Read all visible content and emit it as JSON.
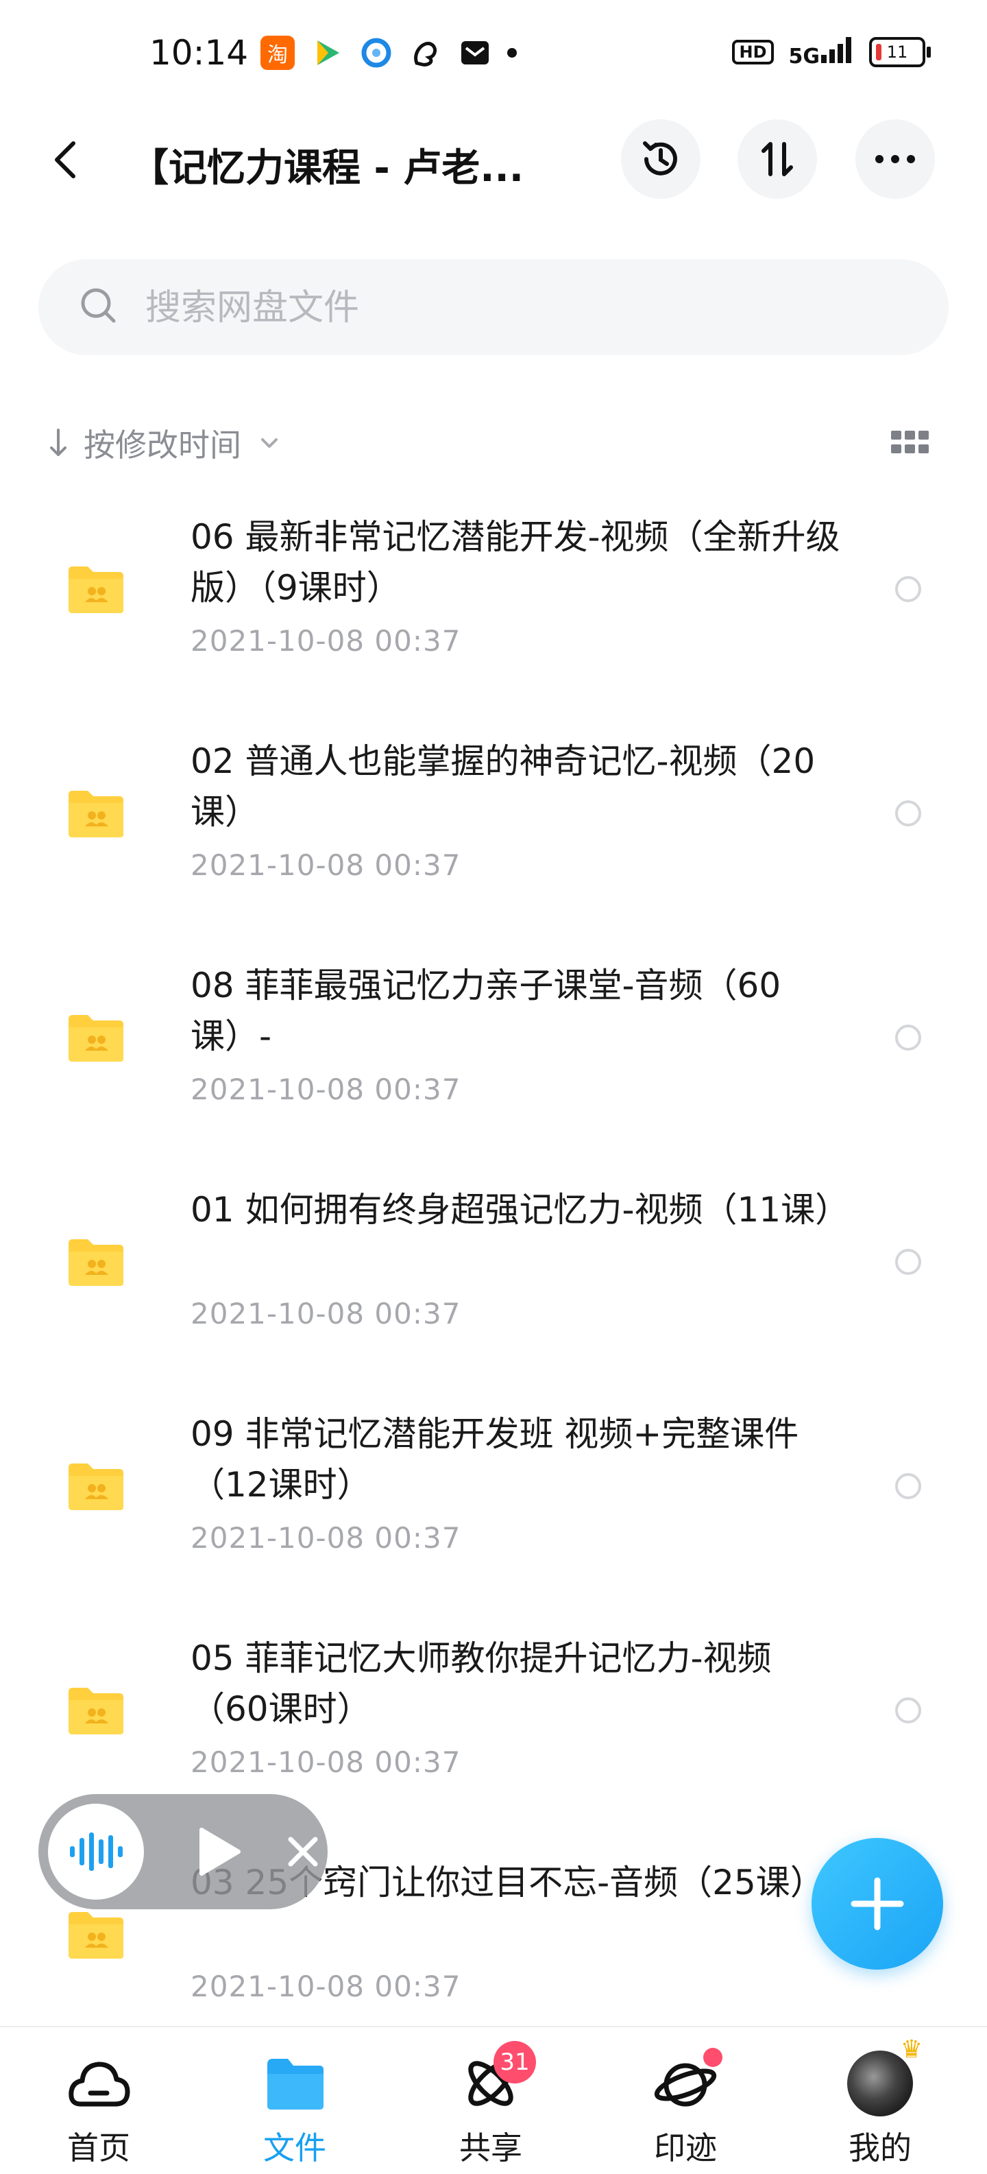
{
  "status_bar": {
    "time": "10:14",
    "network": "5G",
    "hd": "HD",
    "battery": "11"
  },
  "header": {
    "title": "【记忆力课程 - 卢老..."
  },
  "search": {
    "placeholder": "搜索网盘文件"
  },
  "sort": {
    "label": "按修改时间"
  },
  "files": [
    {
      "name": "06 最新非常记忆潜能开发-视频（全新升级版）（9课时）",
      "date": "2021-10-08  00:37"
    },
    {
      "name": "02 普通人也能掌握的神奇记忆-视频（20课）",
      "date": "2021-10-08  00:37"
    },
    {
      "name": "08 菲菲最强记忆力亲子课堂-音频（60课）-",
      "date": "2021-10-08  00:37"
    },
    {
      "name": "01 如何拥有终身超强记忆力-视频（11课）",
      "date": "2021-10-08  00:37"
    },
    {
      "name": "09 非常记忆潜能开发班 视频+完整课件（12课时）",
      "date": "2021-10-08  00:37"
    },
    {
      "name": "05 菲菲记忆大师教你提升记忆力-视频（60课时）",
      "date": "2021-10-08  00:37"
    },
    {
      "name": "03 25个窍门让你过目不忘-音频（25课）-",
      "date": "2021-10-08  00:37"
    }
  ],
  "nav": {
    "home": "首页",
    "files": "文件",
    "share": "共享",
    "share_badge": "31",
    "trace": "印迹",
    "me": "我的"
  },
  "colors": {
    "accent": "#18a0f0",
    "folder": "#ffd54a",
    "badge": "#ff4d6d"
  }
}
